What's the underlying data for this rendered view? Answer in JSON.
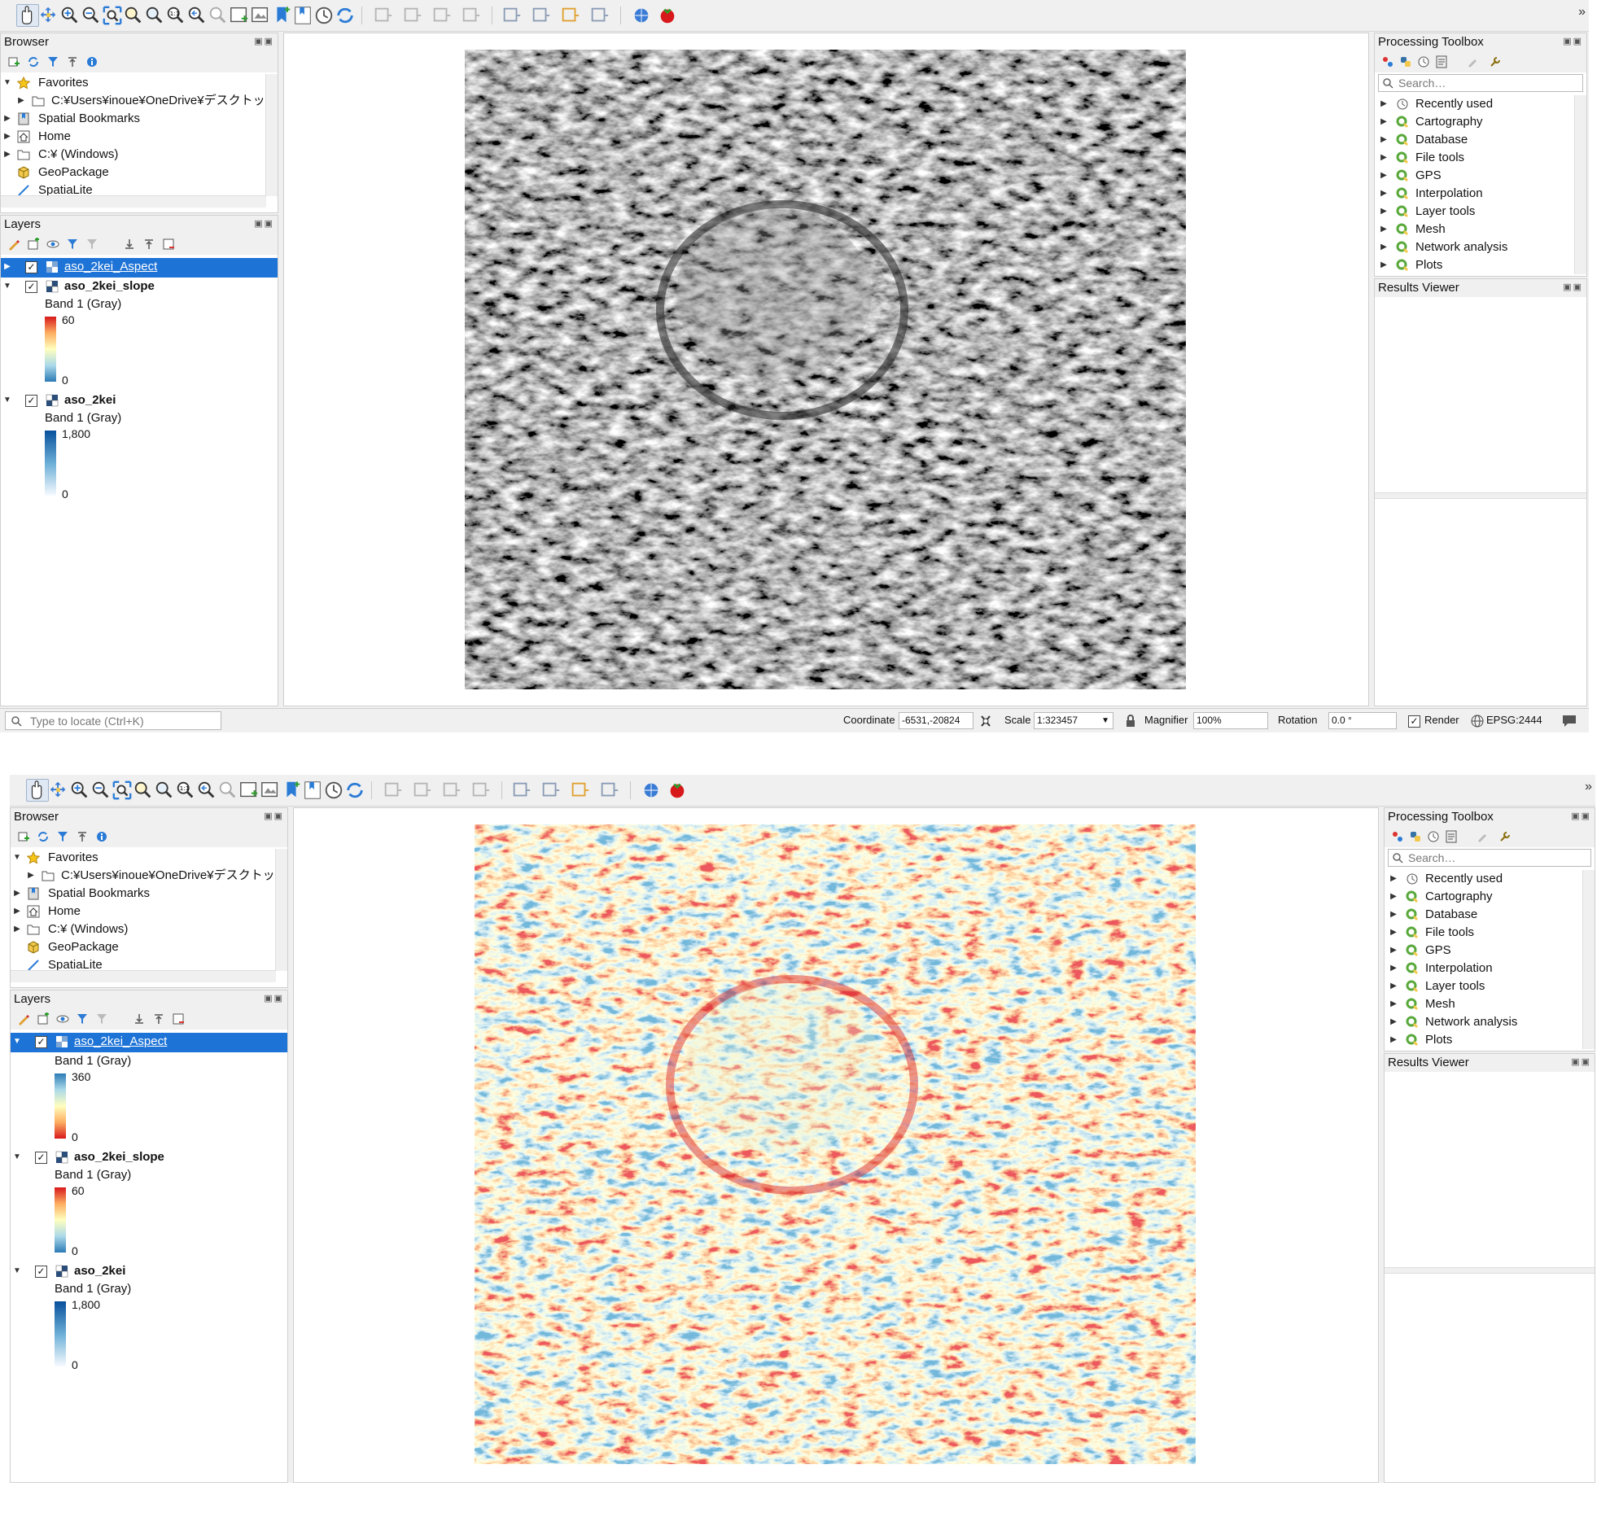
{
  "toolbar": {
    "buttons": [
      "pan-map",
      "pan-to-selection",
      "zoom-in",
      "zoom-out",
      "zoom-full",
      "zoom-to-selection",
      "zoom-to-layer",
      "zoom-native",
      "zoom-last",
      "zoom-next",
      "new-map-view",
      "new-3d-view",
      "new-bookmark",
      "show-bookmarks",
      "temporal-controller",
      "refresh"
    ],
    "overflow_label": "»"
  },
  "window1": {
    "browser": {
      "title": "Browser",
      "items": [
        {
          "label": "Favorites",
          "icon": "star-icon"
        },
        {
          "label": "C:¥Users¥inoue¥OneDrive¥デスクトップ",
          "icon": "folder-icon"
        },
        {
          "label": "Spatial Bookmarks",
          "icon": "bookmark-icon"
        },
        {
          "label": "Home",
          "icon": "home-icon"
        },
        {
          "label": "C:¥ (Windows)",
          "icon": "folder-icon"
        },
        {
          "label": "GeoPackage",
          "icon": "geopackage-icon"
        },
        {
          "label": "SpatiaLite",
          "icon": "spatialite-icon"
        }
      ]
    },
    "layers": {
      "title": "Layers",
      "items": [
        {
          "name": "aso_2kei_Aspect",
          "selected": true,
          "expanded": false
        },
        {
          "name": "aso_2kei_slope",
          "band": "Band 1 (Gray)",
          "max": "60",
          "min": "0"
        },
        {
          "name": "aso_2kei",
          "band": "Band 1 (Gray)",
          "max": "1,800",
          "min": "0"
        }
      ]
    },
    "toolbox": {
      "title": "Processing Toolbox",
      "search_placeholder": "Search…",
      "items": [
        "Recently used",
        "Cartography",
        "Database",
        "File tools",
        "GPS",
        "Interpolation",
        "Layer tools",
        "Mesh",
        "Network analysis",
        "Plots"
      ]
    },
    "results": {
      "title": "Results Viewer"
    },
    "status": {
      "locate_placeholder": "Type to locate (Ctrl+K)",
      "coordinate_label": "Coordinate",
      "coordinate_value": "-6531,-20824",
      "scale_label": "Scale",
      "scale_value": "1:323457",
      "magnifier_label": "Magnifier",
      "magnifier_value": "100%",
      "rotation_label": "Rotation",
      "rotation_value": "0.0 °",
      "render_label": "Render",
      "crs_label": "EPSG:2444"
    }
  },
  "window2": {
    "browser": {
      "title": "Browser",
      "items": [
        {
          "label": "Favorites"
        },
        {
          "label": "C:¥Users¥inoue¥OneDrive¥デスクトップ"
        },
        {
          "label": "Spatial Bookmarks"
        },
        {
          "label": "Home"
        },
        {
          "label": "C:¥ (Windows)"
        },
        {
          "label": "GeoPackage"
        },
        {
          "label": "SpatiaLite"
        }
      ]
    },
    "layers": {
      "title": "Layers",
      "items": [
        {
          "name": "aso_2kei_Aspect",
          "selected": true,
          "band": "Band 1 (Gray)",
          "max": "360",
          "min": "0"
        },
        {
          "name": "aso_2kei_slope",
          "band": "Band 1 (Gray)",
          "max": "60",
          "min": "0"
        },
        {
          "name": "aso_2kei",
          "band": "Band 1 (Gray)",
          "max": "1,800",
          "min": "0"
        }
      ]
    },
    "toolbox": {
      "title": "Processing Toolbox",
      "search_placeholder": "Search…",
      "items": [
        "Recently used",
        "Cartography",
        "Database",
        "File tools",
        "GPS",
        "Interpolation",
        "Layer tools",
        "Mesh",
        "Network analysis",
        "Plots"
      ]
    },
    "results": {
      "title": "Results Viewer"
    }
  },
  "colors": {
    "selection": "#1e73d6",
    "slope_ramp": [
      "#2c7bb6",
      "#abd9e9",
      "#ffffbf",
      "#fdae61",
      "#d7191c"
    ],
    "elevation_ramp": [
      "#f7fbff",
      "#6baed6",
      "#08519c"
    ]
  }
}
